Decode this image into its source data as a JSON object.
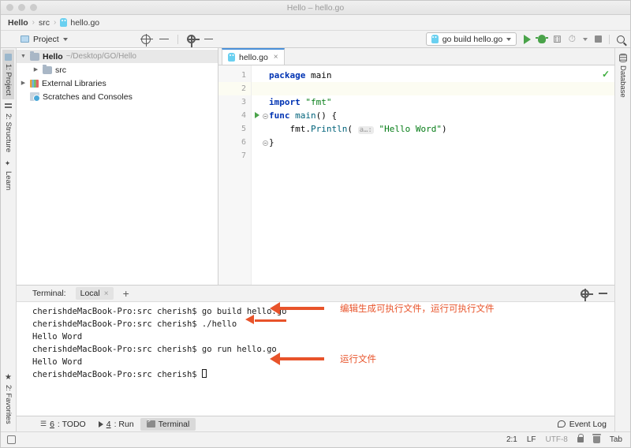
{
  "window": {
    "title": "Hello – hello.go",
    "traffic_lights": [
      "close",
      "minimize",
      "zoom"
    ]
  },
  "breadcrumb": {
    "project": "Hello",
    "folder": "src",
    "file": "hello.go",
    "separator": "›"
  },
  "toolbar": {
    "project_label": "Project",
    "run_config": "go build hello.go",
    "icons": [
      "locate-icon",
      "collapse-all-icon",
      "gear-icon",
      "minimize-icon",
      "run-icon",
      "debug-icon",
      "run-coverage-icon",
      "profile-icon",
      "stop-icon",
      "search-icon"
    ]
  },
  "left_tool_bar": {
    "tabs": [
      {
        "label": "1: Project",
        "active": true
      },
      {
        "label": "2: Structure",
        "active": false
      },
      {
        "label": "Learn",
        "active": false
      }
    ],
    "bottom": [
      {
        "label": "2: Favorites",
        "active": false
      }
    ]
  },
  "right_tool_bar": {
    "tabs": [
      {
        "label": "Database",
        "active": false
      }
    ]
  },
  "project_tree": {
    "nodes": [
      {
        "name": "Hello",
        "path": "~/Desktop/GO/Hello",
        "icon": "folder-icon",
        "expanded": true,
        "bold": true,
        "selected": true,
        "indent": 0
      },
      {
        "name": "src",
        "path": "",
        "icon": "folder-icon",
        "expanded": false,
        "bold": false,
        "selected": false,
        "indent": 1
      },
      {
        "name": "External Libraries",
        "path": "",
        "icon": "library-icon",
        "expanded": false,
        "bold": false,
        "selected": false,
        "indent": 0
      },
      {
        "name": "Scratches and Consoles",
        "path": "",
        "icon": "scratches-icon",
        "expanded": null,
        "bold": false,
        "selected": false,
        "indent": 0
      }
    ]
  },
  "editor": {
    "tab": "hello.go",
    "tab_close": "×",
    "inspection_status": "✓",
    "line_numbers": [
      "1",
      "2",
      "3",
      "4",
      "5",
      "6",
      "7"
    ],
    "lines": [
      {
        "n": "1",
        "tokens": [
          {
            "t": "package ",
            "c": "kw"
          },
          {
            "t": "main",
            "c": "pkg"
          }
        ]
      },
      {
        "n": "2",
        "tokens": []
      },
      {
        "n": "3",
        "tokens": [
          {
            "t": "import ",
            "c": "kw"
          },
          {
            "t": "\"fmt\"",
            "c": "str"
          }
        ]
      },
      {
        "n": "4",
        "tokens": [
          {
            "t": "func ",
            "c": "kw"
          },
          {
            "t": "main",
            "c": "fn"
          },
          {
            "t": "() {",
            "c": "id"
          }
        ]
      },
      {
        "n": "5",
        "tokens": [
          {
            "t": "    fmt.",
            "c": "id"
          },
          {
            "t": "Println",
            "c": "fn"
          },
          {
            "t": "( ",
            "c": "id"
          },
          {
            "t": "a…:",
            "c": "hint"
          },
          {
            "t": " ",
            "c": "id"
          },
          {
            "t": "\"Hello Word\"",
            "c": "str"
          },
          {
            "t": ")",
            "c": "id"
          }
        ]
      },
      {
        "n": "6",
        "tokens": [
          {
            "t": "}",
            "c": "id"
          }
        ]
      },
      {
        "n": "7",
        "tokens": []
      }
    ],
    "highlight_line": 2,
    "gutter_run_line": 4
  },
  "terminal": {
    "label": "Terminal:",
    "tab": "Local",
    "tab_close": "×",
    "add": "+",
    "header_icons": [
      "gear-icon",
      "minimize-icon"
    ],
    "lines": [
      "cherishdeMacBook-Pro:src cherish$ go build hello.go",
      "cherishdeMacBook-Pro:src cherish$ ./hello",
      "Hello Word",
      "cherishdeMacBook-Pro:src cherish$ go run hello.go",
      "Hello Word",
      "cherishdeMacBook-Pro:src cherish$ "
    ],
    "cursor_line_index": 5
  },
  "annotations": {
    "color": "#e8532a",
    "items": [
      {
        "text": "编辑生成可执行文件，运行可执行文件"
      },
      {
        "text": "运行文件"
      }
    ]
  },
  "tool_window_bar": {
    "items": [
      {
        "num": "6",
        "label": ": TODO",
        "icon": "todo-icon",
        "active": false
      },
      {
        "num": "4",
        "label": ": Run",
        "icon": "run-icon",
        "active": false
      },
      {
        "num": "",
        "label": "Terminal",
        "icon": "terminal-icon",
        "active": true
      }
    ],
    "event_log": "Event Log"
  },
  "status_bar": {
    "caret": "2:1",
    "line_sep": "LF",
    "encoding": "UTF-8",
    "indent": "Tab",
    "icons": [
      "lock-icon",
      "trash-icon"
    ]
  },
  "colors": {
    "accent_green": "#4aa34a",
    "annotation": "#e8532a",
    "tab_underline": "#4a90d9",
    "keyword": "#0033b3",
    "string": "#067d17"
  }
}
